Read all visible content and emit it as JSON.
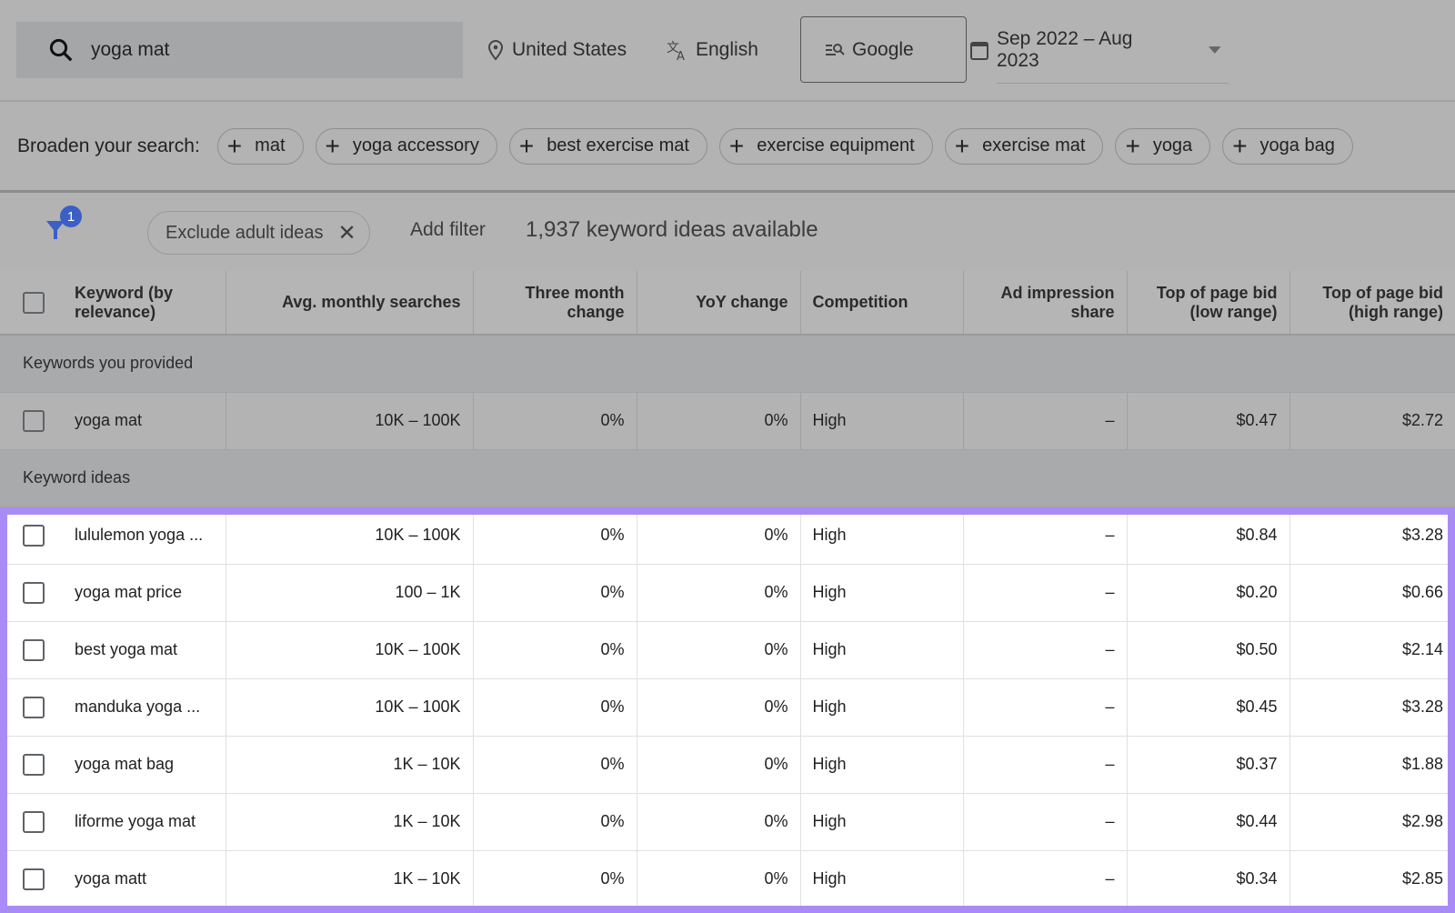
{
  "search": {
    "query": "yoga mat"
  },
  "toolbar": {
    "location": "United States",
    "language": "English",
    "engine": "Google",
    "date_range": "Sep 2022 – Aug 2023"
  },
  "broaden": {
    "label": "Broaden your search:",
    "chips": [
      "mat",
      "yoga accessory",
      "best exercise mat",
      "exercise equipment",
      "exercise mat",
      "yoga",
      "yoga bag"
    ]
  },
  "filters": {
    "badge": "1",
    "active_filter": "Exclude adult ideas",
    "add_filter": "Add filter",
    "count_text": "1,937 keyword ideas available"
  },
  "table": {
    "headers": [
      "Keyword (by relevance)",
      "Avg. monthly searches",
      "Three month change",
      "YoY change",
      "Competition",
      "Ad impression share",
      "Top of page bid (low range)",
      "Top of page bid (high range)"
    ],
    "group_provided": "Keywords you provided",
    "provided": [
      [
        "yoga mat",
        "10K – 100K",
        "0%",
        "0%",
        "High",
        "–",
        "$0.47",
        "$2.72"
      ]
    ],
    "group_ideas": "Keyword ideas",
    "ideas": [
      [
        "lululemon yoga ...",
        "10K – 100K",
        "0%",
        "0%",
        "High",
        "–",
        "$0.84",
        "$3.28"
      ],
      [
        "yoga mat price",
        "100 – 1K",
        "0%",
        "0%",
        "High",
        "–",
        "$0.20",
        "$0.66"
      ],
      [
        "best yoga mat",
        "10K – 100K",
        "0%",
        "0%",
        "High",
        "–",
        "$0.50",
        "$2.14"
      ],
      [
        "manduka yoga ...",
        "10K – 100K",
        "0%",
        "0%",
        "High",
        "–",
        "$0.45",
        "$3.28"
      ],
      [
        "yoga mat bag",
        "1K – 10K",
        "0%",
        "0%",
        "High",
        "–",
        "$0.37",
        "$1.88"
      ],
      [
        "liforme yoga mat",
        "1K – 10K",
        "0%",
        "0%",
        "High",
        "–",
        "$0.44",
        "$2.98"
      ],
      [
        "yoga matt",
        "1K – 10K",
        "0%",
        "0%",
        "High",
        "–",
        "$0.34",
        "$2.85"
      ]
    ]
  },
  "colors": {
    "highlight_border": "#a98bf7",
    "filter_badge": "#3b5fc6",
    "overlay": "#b3b3b3"
  }
}
